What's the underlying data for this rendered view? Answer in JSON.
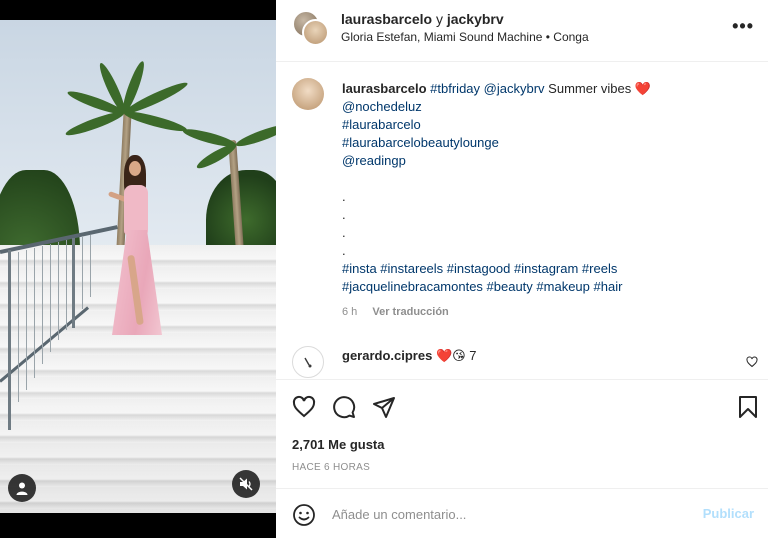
{
  "header": {
    "user1": "laurasbarcelo",
    "connector": "y",
    "user2": "jackybrv",
    "audio": "Gloria Estefan, Miami Sound Machine • Conga",
    "more_label": "•••"
  },
  "caption": {
    "user": "laurasbarcelo",
    "line1_tag1": "#tbfriday",
    "line1_mention": "@jackybrv",
    "line1_text": "Summer vibes",
    "line1_emoji": "❤️",
    "mention2": "@nochedeluz",
    "tag2": "#laurabarcelo",
    "tag3": "#laurabarcelobeautylounge",
    "mention3": "@readingp",
    "dots": [
      ".",
      ".",
      ".",
      "."
    ],
    "hashtags_line1": "#insta #instareels #instagood #instagram #reels",
    "hashtags_line2": "#jacquelinebracamontes #beauty #makeup #hair",
    "time": "6 h",
    "translate_label": "Ver traducción"
  },
  "comment": {
    "user": "gerardo.cipres",
    "text": "❤️😘 7"
  },
  "actions": {
    "likes": "2,701 Me gusta",
    "time_ago": "HACE 6 HORAS"
  },
  "add_comment": {
    "placeholder": "Añade un comentario...",
    "publish_label": "Publicar"
  },
  "icons": {
    "like": "heart-icon",
    "comment": "comment-icon",
    "share": "paper-plane-icon",
    "save": "bookmark-icon",
    "emoji": "smiley-icon",
    "mute": "speaker-muted-icon",
    "tagged_user": "person-icon"
  },
  "colors": {
    "link": "#00376b",
    "publish_disabled": "#b2dffc",
    "heart": "#ed4956"
  }
}
